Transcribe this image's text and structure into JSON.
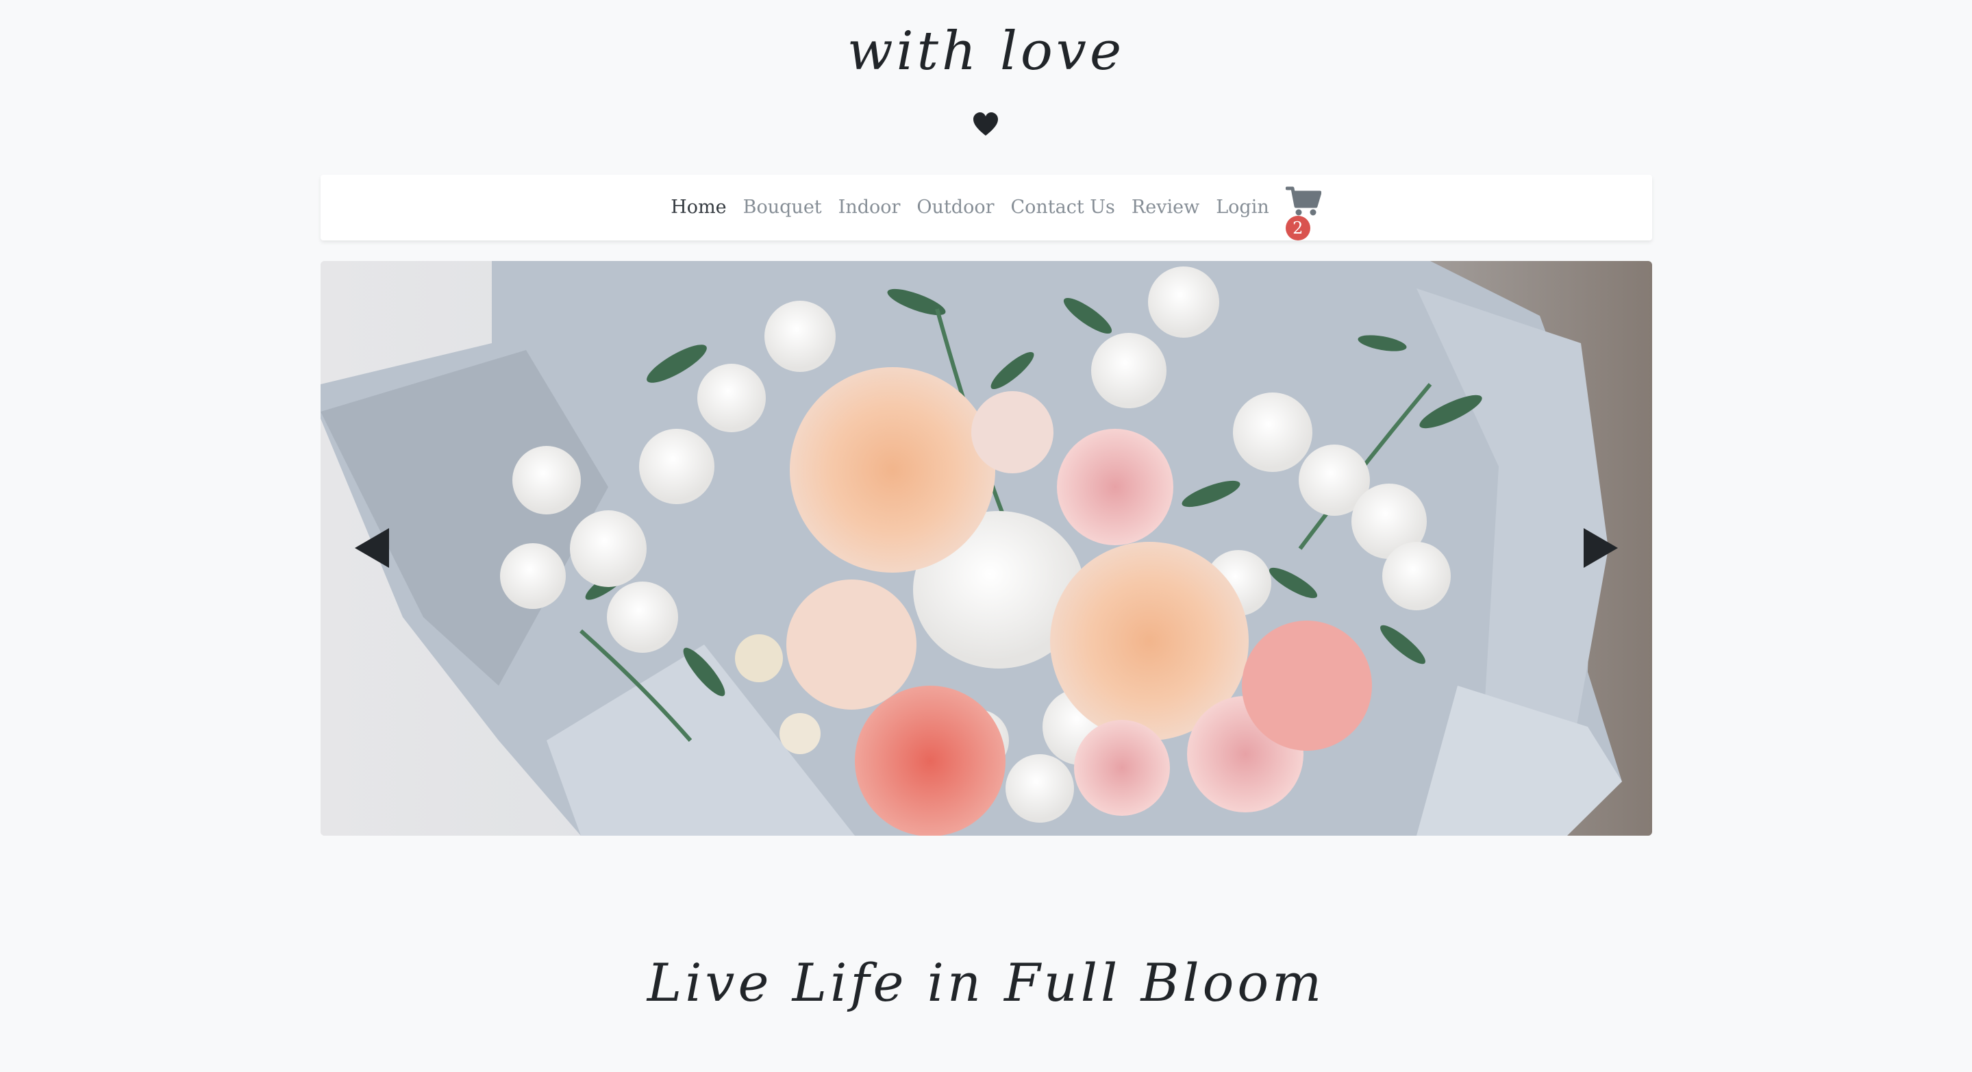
{
  "brand": {
    "title": "with love",
    "icon": "heart-icon"
  },
  "nav": {
    "items": [
      {
        "label": "Home",
        "active": true
      },
      {
        "label": "Bouquet",
        "active": false
      },
      {
        "label": "Indoor",
        "active": false
      },
      {
        "label": "Outdoor",
        "active": false
      },
      {
        "label": "Contact Us",
        "active": false
      },
      {
        "label": "Review",
        "active": false
      },
      {
        "label": "Login",
        "active": false
      }
    ],
    "cart": {
      "icon": "cart-icon",
      "count": "2"
    }
  },
  "carousel": {
    "image": "flower-bouquet-photo",
    "prev_icon": "arrow-left-icon",
    "next_icon": "arrow-right-icon"
  },
  "tagline": "Live Life in Full Bloom",
  "colors": {
    "background": "#f8f9fa",
    "text": "#212529",
    "nav_link": "#868e96",
    "nav_active": "#343a40",
    "badge": "#d9534f"
  }
}
